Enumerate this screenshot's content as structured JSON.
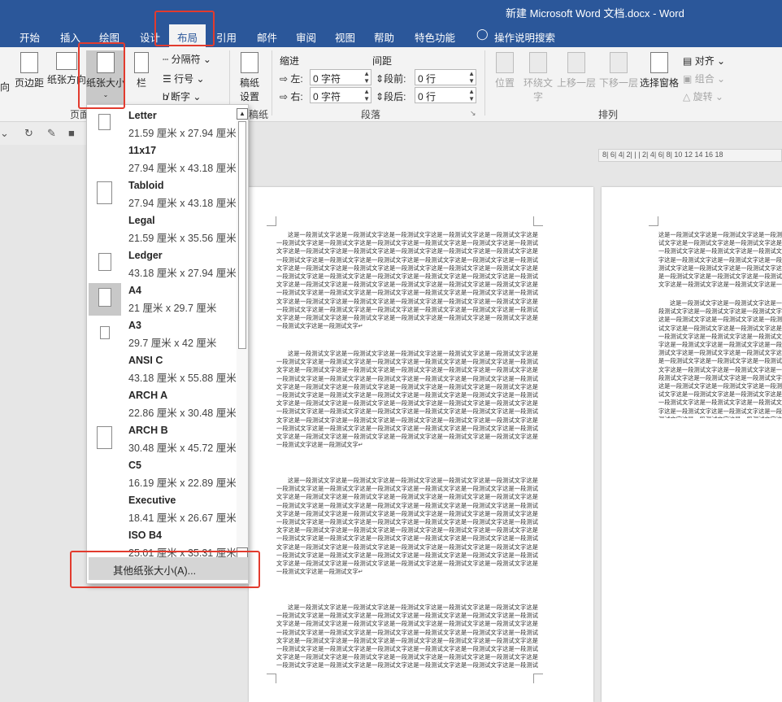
{
  "window": {
    "title": "新建 Microsoft Word 文档.docx  -  Word"
  },
  "tabs": [
    "开始",
    "插入",
    "绘图",
    "设计",
    "布局",
    "引用",
    "邮件",
    "审阅",
    "视图",
    "帮助",
    "特色功能",
    "操作说明搜索"
  ],
  "ribbon": {
    "page_setup": {
      "orientation_label": "向",
      "margins_label": "页边距",
      "orientation_full_label": "纸张方向",
      "size_label": "纸张大小",
      "columns_label": "栏",
      "breaks_label": "分隔符",
      "line_numbers_label": "行号",
      "hyphenation_label": "断字",
      "group_label": "页面设置"
    },
    "manuscript": {
      "label_line1": "稿纸",
      "label_line2": "设置",
      "group_label": "稿纸"
    },
    "paragraph": {
      "indent_title": "缩进",
      "spacing_title": "间距",
      "left_label": "左:",
      "left_value": "0 字符",
      "right_label": "右:",
      "right_value": "0 字符",
      "before_label": "段前:",
      "before_value": "0 行",
      "after_label": "段后:",
      "after_value": "0 行",
      "group_label": "段落"
    },
    "arrange": {
      "position_label": "位置",
      "wrap_label_line1": "环绕文",
      "wrap_label_line2": "字",
      "forward_label": "上移一层",
      "backward_label": "下移一层",
      "selection_pane_label": "选择窗格",
      "align_label": "对齐",
      "group_objects_label": "组合",
      "rotate_label": "旋转",
      "group_label": "排列"
    }
  },
  "ruler_text": "8| 6| 4| 2| |  | 2| 4| 6| 8| 10 12 14 16 18",
  "paper_sizes": [
    {
      "name": "Letter",
      "dims": "21.59 厘米 x 27.94 厘米",
      "selected": false
    },
    {
      "name": "11x17",
      "dims": "27.94 厘米 x 43.18 厘米",
      "selected": false
    },
    {
      "name": "Tabloid",
      "dims": "27.94 厘米 x 43.18 厘米",
      "selected": false
    },
    {
      "name": "Legal",
      "dims": "21.59 厘米 x 35.56 厘米",
      "selected": false
    },
    {
      "name": "Ledger",
      "dims": "43.18 厘米 x 27.94 厘米",
      "selected": false
    },
    {
      "name": "A4",
      "dims": "21 厘米 x 29.7 厘米",
      "selected": true
    },
    {
      "name": "A3",
      "dims": "29.7 厘米 x 42 厘米",
      "selected": false
    },
    {
      "name": "ANSI C",
      "dims": "43.18 厘米 x 55.88 厘米",
      "selected": false
    },
    {
      "name": "ARCH A",
      "dims": "22.86 厘米 x 30.48 厘米",
      "selected": false
    },
    {
      "name": "ARCH B",
      "dims": "30.48 厘米 x 45.72 厘米",
      "selected": false
    },
    {
      "name": "C5",
      "dims": "16.19 厘米 x 22.89 厘米",
      "selected": false
    },
    {
      "name": "Executive",
      "dims": "18.41 厘米 x 26.67 厘米",
      "selected": false
    },
    {
      "name": "ISO B4",
      "dims": "25.01 厘米 x 35.31 厘米",
      "selected": false
    }
  ],
  "more_sizes_label": "其他纸张大小(A)...",
  "document": {
    "paragraph_text": "这是一段测试文字这是一段测试文字这是一段测试文字这是一段测试文字这是一段测试文字这是一段测试文字这是一段测试文字这是一段测试文字这是一段测试文字这是一段测试文字这是一段测试文字这是一段测试文字这是一段测试文字这是一段测试文字这是一段测试文字这是一段测试文字这是一段测试文字这是一段测试文字这是一段测试文字这是一段测试文字这是一段测试文字这是一段测试文字这是一段测试文字这是一段测试文字这是一段测试文字这是一段测试文字这是一段测试文字这是一段测试文字这是一段测试文字这是一段测试文字这是一段测试文字这是一段测试文字这是一段测试文字这是一段测试文字这是一段测试文字这是一段测试文字这是一段测试文字这是一段测试文字这是一段测试文字这是一段测试文字这是一段测试文字这是一段测试文字这是一段测试文字这是一段测试文字这是一段测试文字这是一段测试文字这是一段测试文字这是一段测试文字这是一段测试文字这是一段测试文字这是一段测试文字这是一段测试文字这是一段测试文字这是一段测试文字这是一段测试文字这是一段测试文字这是一段测试文字这是一段测试文字这是一段测试文字这是一段测试文字这是一段测试文字这是一段测试文字↵"
  },
  "colors": {
    "word_blue": "#2b579a",
    "highlight_red": "#e23b2e"
  }
}
